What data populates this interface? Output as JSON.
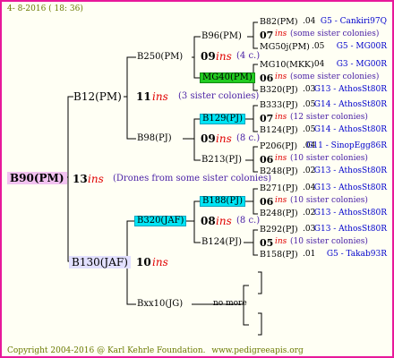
{
  "header_date": "4- 8-2016 ( 18: 36)",
  "footer": {
    "copyright": "Copyright 2004-2016 @ Karl Kehrle Foundation.",
    "site": "www.pedigreeapis.org"
  },
  "root": {
    "name": "B90(PM)",
    "num": "13",
    "ins": "ins",
    "note": "(Drones from some sister colonies)"
  },
  "gen1": {
    "top": {
      "name": "B12(PM)",
      "num": "11",
      "ins": "ins",
      "note": "(3 sister colonies)"
    },
    "bottom": {
      "name": "B130(JAF)",
      "num": "10",
      "ins": "ins"
    }
  },
  "gen2": {
    "b250": {
      "name": "B250(PM)"
    },
    "b98": {
      "name": "B98(PJ)"
    },
    "b320": {
      "name": "B320(JAF)",
      "num": "08",
      "ins": "ins",
      "note": "(8 c.)"
    },
    "bxx10": {
      "name": "Bxx10(JG)",
      "note": "no more"
    }
  },
  "gen3": {
    "b96": {
      "name": "B96(PM)",
      "num": "09",
      "ins": "ins",
      "note": "(4 c.)"
    },
    "mg40": {
      "name": "MG40(PM)"
    },
    "b129": {
      "name": "B129(PJ)",
      "num": "09",
      "ins": "ins",
      "note": "(8 c.)"
    },
    "b213": {
      "name": "B213(PJ)"
    },
    "b188": {
      "name": "B188(PJ)"
    },
    "b124": {
      "name": "B124(PJ)"
    }
  },
  "gen4": [
    {
      "name": "B82(PM)",
      "year": ".04",
      "line": "G5 - Cankiri97Q"
    },
    {
      "num": "07",
      "ins": "ins",
      "note": "(some sister colonies)"
    },
    {
      "name": "MG50j(PM)",
      "year": ".05",
      "line": "G5 - MG00R"
    },
    {
      "name": "MG10(MKK)",
      "year": ".04",
      "line": "G3 - MG00R"
    },
    {
      "num": "06",
      "ins": "ins",
      "note": "(some sister colonies)"
    },
    {
      "name": "B320(PJ)",
      "year": ".03",
      "line": "G13 - AthosSt80R"
    },
    {
      "name": "B333(PJ)",
      "year": ".05",
      "line": "G14 - AthosSt80R"
    },
    {
      "num": "07",
      "ins": "ins",
      "note": "(12 sister colonies)"
    },
    {
      "name": "B124(PJ)",
      "year": ".05",
      "line": "G14 - AthosSt80R"
    },
    {
      "name": "P206(PJ)",
      "year": ".04",
      "line": "G11 - SinopEgg86R"
    },
    {
      "num": "06",
      "ins": "ins",
      "note": "(10 sister colonies)"
    },
    {
      "name": "B248(PJ)",
      "year": ".02",
      "line": "G13 - AthosSt80R"
    },
    {
      "name": "B271(PJ)",
      "year": ".04",
      "line": "G13 - AthosSt80R"
    },
    {
      "num": "06",
      "ins": "ins",
      "note": "(10 sister colonies)"
    },
    {
      "name": "B248(PJ)",
      "year": ".02",
      "line": "G13 - AthosSt80R"
    },
    {
      "name": "B292(PJ)",
      "year": ".03",
      "line": "G13 - AthosSt80R"
    },
    {
      "num": "05",
      "ins": "ins",
      "note": "(10 sister colonies)"
    },
    {
      "name": "B158(PJ)",
      "year": ".01",
      "line": "G5 - Takab93R"
    }
  ],
  "colors": {
    "frame": "#e8189a",
    "background": "#fffff4",
    "root_highlight": "#f2c2f0",
    "lavender_highlight": "#e2e0ff",
    "cyan_highlight": "#00e5f5",
    "green_highlight": "#22cc22",
    "ins_text": "#e00000",
    "line_text": "#0000cc",
    "note_text": "#4b22a6",
    "header_text": "#6b7a00"
  }
}
